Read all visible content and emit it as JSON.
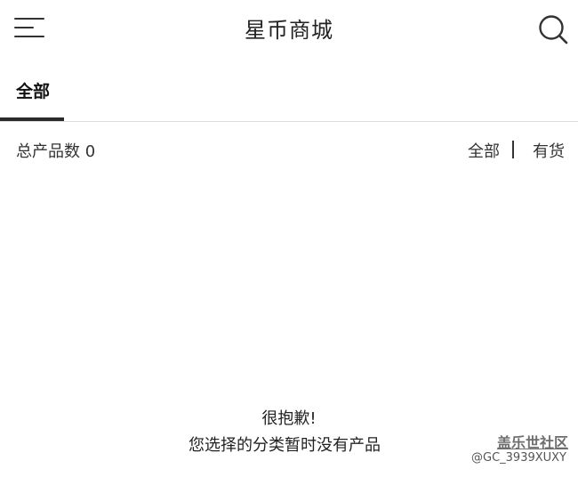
{
  "header": {
    "title": "星币商城",
    "menu_icon": "hamburger-menu-icon",
    "search_icon": "search-icon"
  },
  "tabs": [
    {
      "label": "全部",
      "active": true
    }
  ],
  "summary": {
    "count_text": "总产品数 0",
    "filter_all": "全部",
    "separator": "|",
    "filter_in_stock": "有货"
  },
  "empty_state": {
    "title": "很抱歉!",
    "message": "您选择的分类暂时没有产品"
  },
  "watermark": {
    "name": "盖乐世社区",
    "user": "@GC_3939XUXY"
  }
}
